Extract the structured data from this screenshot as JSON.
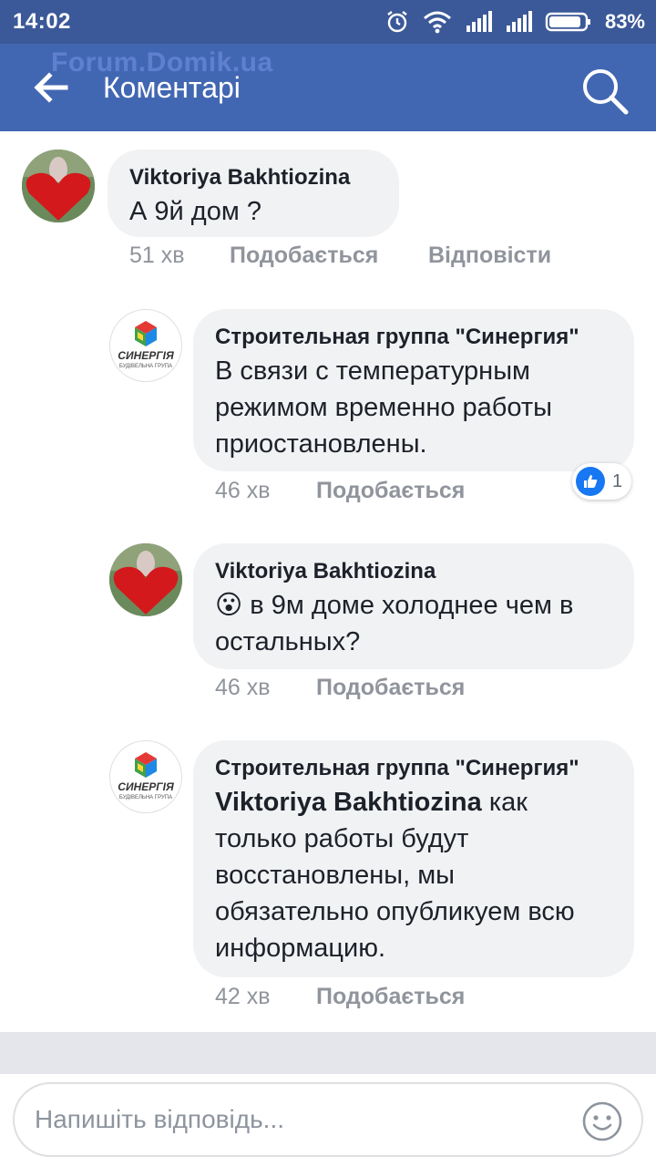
{
  "status_bar": {
    "time": "14:02",
    "battery": "83%"
  },
  "app_bar": {
    "title": "Коментарі",
    "watermark": "Forum.Domik.ua",
    "color": "#4267b2"
  },
  "comments": [
    {
      "author": "Viktoriya Bakhtiozina",
      "text": "А 9й дом ?",
      "time": "51 хв",
      "like_label": "Подобається",
      "reply_label": "Відповісти"
    },
    {
      "author": "Строительная группа \"Синергия\"",
      "text": "В связи с температурным режимом временно работы приостановлены.",
      "time": "46 хв",
      "like_label": "Подобається",
      "reactions": "1",
      "logo_text": "СИНЕРГІЯ",
      "logo_sub": "БУДІВЕЛЬНА ГРУПА"
    },
    {
      "author": "Viktoriya Bakhtiozina",
      "emoji": "😮",
      "text": "в 9м доме холоднее чем в остальных?",
      "time": "46 хв",
      "like_label": "Подобається"
    },
    {
      "author": "Строительная группа \"Синергия\"",
      "mention": "Viktoriya Bakhtiozina",
      "text": "как только работы будут восстановлены, мы обязательно опубликуем всю информацию.",
      "time": "42 хв",
      "like_label": "Подобається",
      "logo_text": "СИНЕРГІЯ",
      "logo_sub": "БУДІВЕЛЬНА ГРУПА"
    }
  ],
  "composer": {
    "placeholder": "Напишіть відповідь..."
  }
}
